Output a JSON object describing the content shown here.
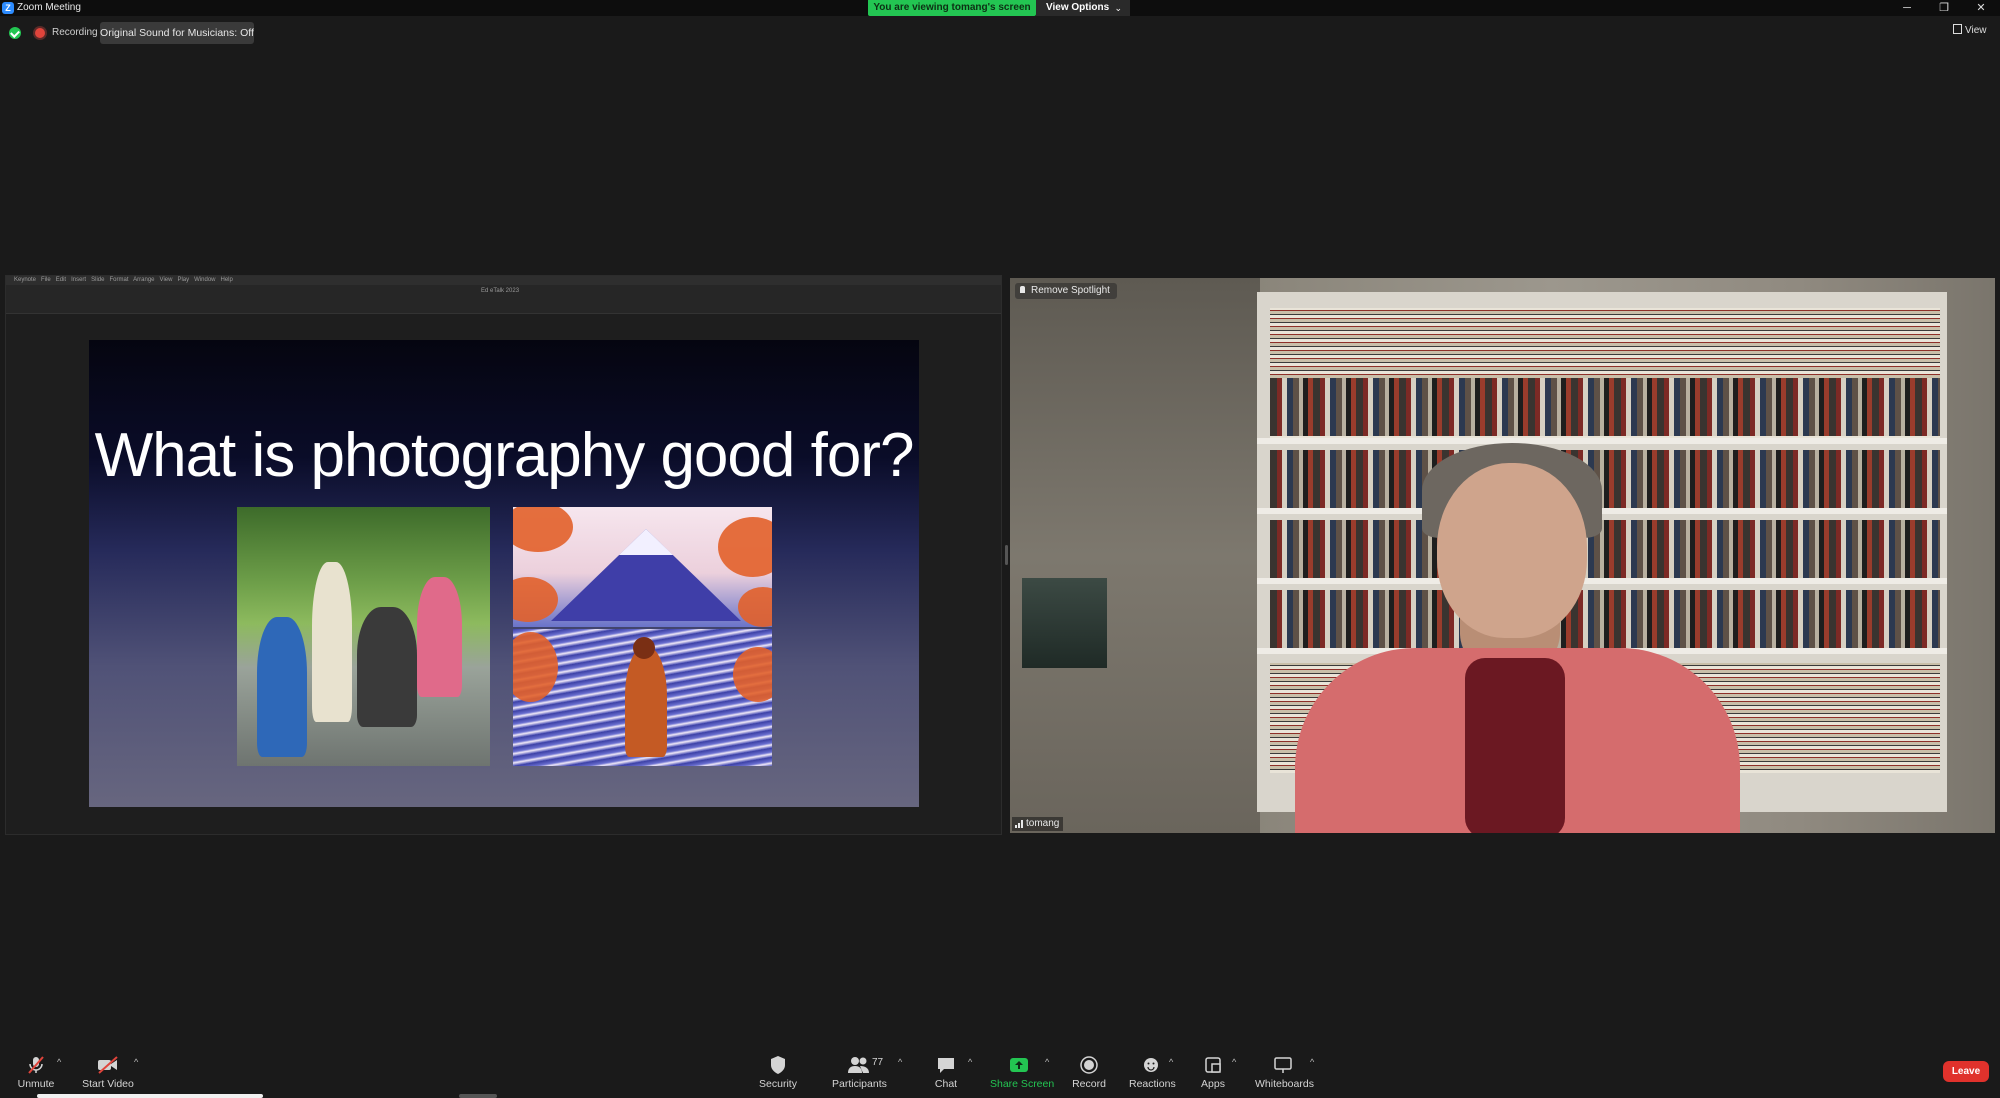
{
  "window": {
    "title": "Zoom Meeting",
    "viewing_banner": "You are viewing tomang's screen",
    "view_options_label": "View Options",
    "minimize": "─",
    "restore": "❐",
    "close": "✕"
  },
  "status": {
    "recording_label": "Recording",
    "original_sound_label": "Original Sound for Musicians: Off",
    "view_label": "View"
  },
  "shared_screen": {
    "document_title": "Ed eTalk 2023",
    "menubar_items": [
      "Keynote",
      "File",
      "Edit",
      "Insert",
      "Slide",
      "Format",
      "Arrange",
      "View",
      "Play",
      "Window",
      "Help"
    ],
    "slide_title": "What is photography good for?"
  },
  "video": {
    "remove_spotlight_label": "Remove Spotlight",
    "participant_name": "tomang"
  },
  "toolbar": {
    "unmute": "Unmute",
    "start_video": "Start Video",
    "security": "Security",
    "participants": "Participants",
    "participants_count": "77",
    "chat": "Chat",
    "share_screen": "Share Screen",
    "record": "Record",
    "reactions": "Reactions",
    "apps": "Apps",
    "whiteboards": "Whiteboards",
    "leave": "Leave"
  },
  "colors": {
    "share_green": "#23c552",
    "leave_red": "#e0322c",
    "record_red": "#e0443b"
  }
}
